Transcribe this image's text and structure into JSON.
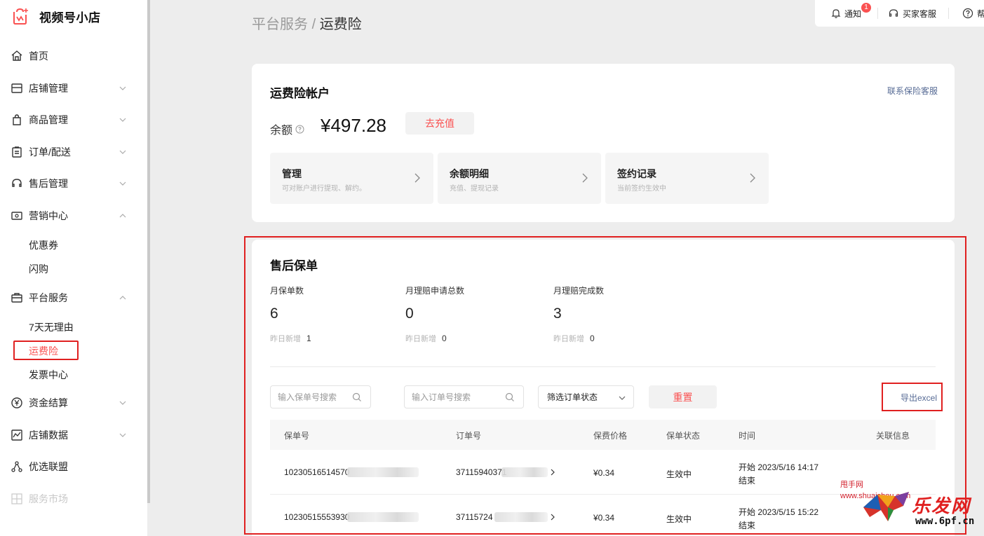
{
  "app": {
    "name": "视频号小店"
  },
  "colors": {
    "accent": "#fa5151",
    "link": "#576b95",
    "highlight": "#e02020"
  },
  "sidebar": {
    "items": [
      {
        "label": "首页",
        "icon": "home-icon"
      },
      {
        "label": "店铺管理",
        "icon": "store-icon"
      },
      {
        "label": "商品管理",
        "icon": "bag-icon"
      },
      {
        "label": "订单/配送",
        "icon": "clipboard-icon"
      },
      {
        "label": "售后管理",
        "icon": "headset-icon"
      },
      {
        "label": "营销中心",
        "icon": "ticket-icon"
      },
      {
        "label": "平台服务",
        "icon": "briefcase-icon"
      },
      {
        "label": "资金结算",
        "icon": "yen-icon"
      },
      {
        "label": "店铺数据",
        "icon": "chart-icon"
      },
      {
        "label": "优选联盟",
        "icon": "network-icon"
      },
      {
        "label": "服务市场",
        "icon": "grid-icon"
      }
    ],
    "marketing_sub": [
      "优惠券",
      "闪购"
    ],
    "platform_sub": [
      "7天无理由",
      "运费险",
      "发票中心"
    ]
  },
  "header": {
    "breadcrumb_parent": "平台服务",
    "breadcrumb_sep": "/",
    "breadcrumb_current": "运费险",
    "notify_label": "通知",
    "notify_count": "1",
    "service_label": "买家客服",
    "help_label": "帮"
  },
  "account": {
    "title": "运费险帐户",
    "contact_link": "联系保险客服",
    "balance_label": "余额",
    "balance_value": "¥497.28",
    "recharge_label": "去充值",
    "tiles": [
      {
        "title": "管理",
        "desc": "可对账户进行提现、解约。"
      },
      {
        "title": "余额明细",
        "desc": "充值、提现记录"
      },
      {
        "title": "签约记录",
        "desc": "当前签约生效中"
      }
    ]
  },
  "policies": {
    "title": "售后保单",
    "stats": [
      {
        "label": "月保单数",
        "value": "6",
        "sub_label": "昨日新增",
        "sub_value": "1"
      },
      {
        "label": "月理赔申请总数",
        "value": "0",
        "sub_label": "昨日新增",
        "sub_value": "0"
      },
      {
        "label": "月理赔完成数",
        "value": "3",
        "sub_label": "昨日新增",
        "sub_value": "0"
      }
    ],
    "search_policy_placeholder": "输入保单号搜索",
    "search_order_placeholder": "输入订单号搜索",
    "status_filter": "筛选订单状态",
    "reset_label": "重置",
    "export_label": "导出excel",
    "columns": [
      "保单号",
      "订单号",
      "保费价格",
      "保单状态",
      "时间",
      "关联信息"
    ],
    "rows": [
      {
        "policy_no": "10230516514570",
        "order_no": "37115940371",
        "price": "¥0.34",
        "status": "生效中",
        "start": "开始 2023/5/16 14:17",
        "end": "结束"
      },
      {
        "policy_no": "10230515553930",
        "order_no": "37115724",
        "price": "¥0.34",
        "status": "生效中",
        "start": "开始 2023/5/15 15:22",
        "end": "结束"
      }
    ]
  },
  "watermark": {
    "site_name": "甩手网",
    "site_url": "www.shuaishou.com",
    "brand": "乐发网",
    "brand_url": "www.6pf.cn"
  }
}
